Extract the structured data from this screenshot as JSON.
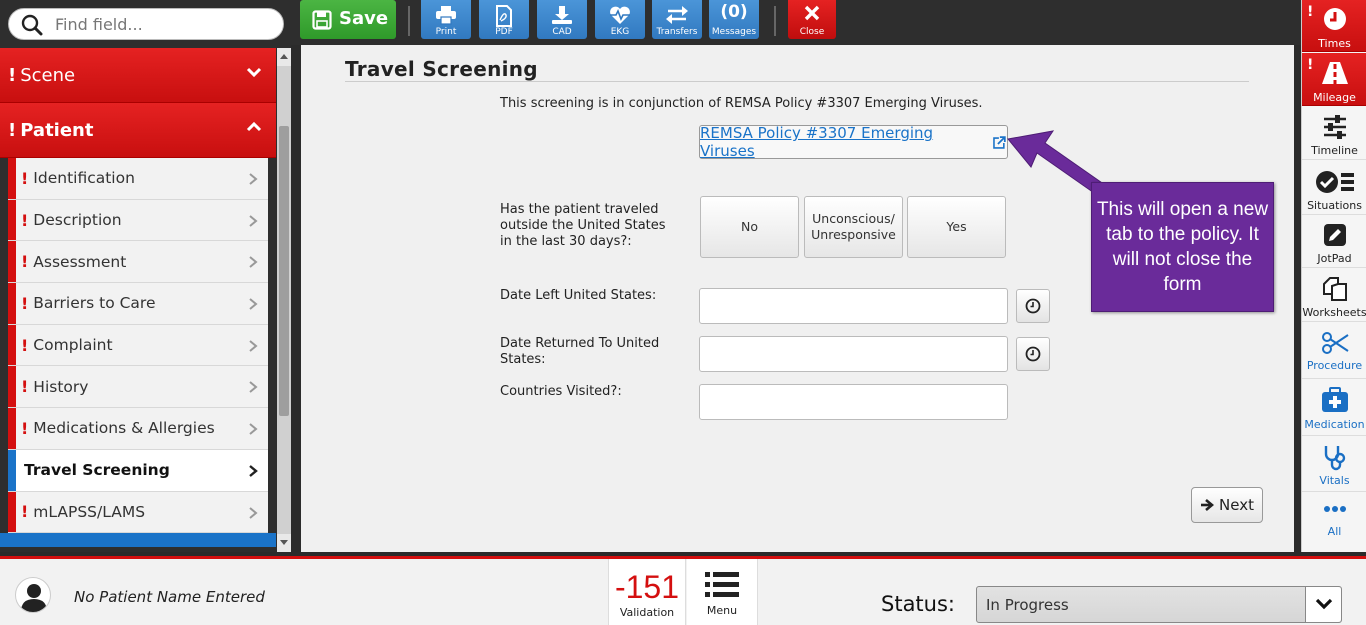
{
  "search": {
    "placeholder": "Find field..."
  },
  "sidebar": {
    "sections": [
      {
        "label": "Scene",
        "alert": "!",
        "expanded": false
      },
      {
        "label": "Patient",
        "alert": "!",
        "expanded": true
      }
    ],
    "items": [
      {
        "label": "Identification",
        "alert": "!"
      },
      {
        "label": "Description",
        "alert": "!"
      },
      {
        "label": "Assessment",
        "alert": "!"
      },
      {
        "label": "Barriers to Care",
        "alert": "!"
      },
      {
        "label": "Complaint",
        "alert": "!"
      },
      {
        "label": "History",
        "alert": "!"
      },
      {
        "label": "Medications & Allergies",
        "alert": "!"
      },
      {
        "label": "Travel Screening",
        "alert": "",
        "active": true
      },
      {
        "label": "mLAPSS/LAMS",
        "alert": "!"
      }
    ]
  },
  "toolbar": {
    "save_label": "Save",
    "print_label": "Print",
    "pdf_label": "PDF",
    "cad_label": "CAD",
    "ekg_label": "EKG",
    "transfers_label": "Transfers",
    "messages_count": "(0)",
    "messages_label": "Messages",
    "close_label": "Close"
  },
  "form": {
    "title": "Travel Screening",
    "intro": "This screening is in conjunction of REMSA Policy #3307 Emerging Viruses.",
    "policy_link": "REMSA Policy #3307 Emerging Viruses",
    "q_traveled": "Has the patient traveled outside the United States in the last 30 days?:",
    "options": [
      "No",
      "Unconscious/ Unresponsive",
      "Yes"
    ],
    "q_date_left": "Date Left United States:",
    "q_date_returned": "Date Returned To United States:",
    "q_countries": "Countries Visited?:",
    "date_left_value": "",
    "date_returned_value": "",
    "countries_value": "",
    "next_label": "Next"
  },
  "callout": {
    "text": "This will open a new tab to the policy. It will not close the form"
  },
  "rail": {
    "items": [
      {
        "label": "Times",
        "alert": "!"
      },
      {
        "label": "Mileage",
        "alert": "!"
      },
      {
        "label": "Timeline"
      },
      {
        "label": "Situations"
      },
      {
        "label": "JotPad"
      },
      {
        "label": "Worksheets"
      },
      {
        "label": "Procedure"
      },
      {
        "label": "Medication"
      },
      {
        "label": "Vitals"
      },
      {
        "label": "All"
      }
    ]
  },
  "bottom": {
    "patient_name": "No Patient Name Entered",
    "validation_count": "-151",
    "validation_label": "Validation",
    "menu_label": "Menu",
    "status_label": "Status:",
    "status_value": "In Progress"
  },
  "colors": {
    "brand_red": "#d40f0f",
    "save_green": "#3aa935",
    "toolbar_blue": "#3a85cc",
    "callout_purple": "#6a2b9a",
    "link_blue": "#1a73c8"
  }
}
